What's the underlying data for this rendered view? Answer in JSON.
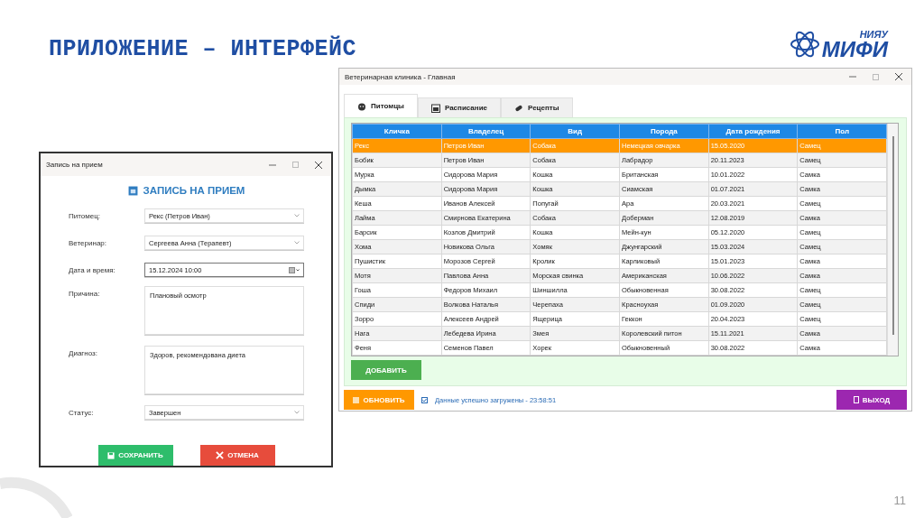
{
  "slide": {
    "title": "ПРИЛОЖЕНИЕ – ИНТЕРФЕЙС",
    "logo_small": "НИЯУ",
    "logo_big": "МИФИ",
    "page_number": "11"
  },
  "main_window": {
    "title": "Ветеринарная клиника - Главная",
    "tabs": [
      {
        "label": "Питомцы",
        "selected": true
      },
      {
        "label": "Расписание",
        "selected": false
      },
      {
        "label": "Рецепты",
        "selected": false
      }
    ],
    "table": {
      "columns": [
        "Кличка",
        "Владелец",
        "Вид",
        "Порода",
        "Дата рождения",
        "Пол"
      ],
      "rows": [
        {
          "cells": [
            "Рекс",
            "Петров Иван",
            "Собака",
            "Немецкая овчарка",
            "15.05.2020",
            "Самец"
          ],
          "selected": true
        },
        {
          "cells": [
            "Бобик",
            "Петров Иван",
            "Собака",
            "Лабрадор",
            "20.11.2023",
            "Самец"
          ],
          "selected": false
        },
        {
          "cells": [
            "Мурка",
            "Сидорова Мария",
            "Кошка",
            "Британская",
            "10.01.2022",
            "Самка"
          ],
          "selected": false
        },
        {
          "cells": [
            "Дымка",
            "Сидорова Мария",
            "Кошка",
            "Сиамская",
            "01.07.2021",
            "Самка"
          ],
          "selected": false
        },
        {
          "cells": [
            "Кеша",
            "Иванов Алексей",
            "Попугай",
            "Ара",
            "20.03.2021",
            "Самец"
          ],
          "selected": false
        },
        {
          "cells": [
            "Лайма",
            "Смирнова Екатерина",
            "Собака",
            "Доберман",
            "12.08.2019",
            "Самка"
          ],
          "selected": false
        },
        {
          "cells": [
            "Барсик",
            "Козлов Дмитрий",
            "Кошка",
            "Мейн-кун",
            "05.12.2020",
            "Самец"
          ],
          "selected": false
        },
        {
          "cells": [
            "Хома",
            "Новикова Ольга",
            "Хомяк",
            "Джунгарский",
            "15.03.2024",
            "Самец"
          ],
          "selected": false
        },
        {
          "cells": [
            "Пушистик",
            "Морозов Сергей",
            "Кролик",
            "Карликовый",
            "15.01.2023",
            "Самка"
          ],
          "selected": false
        },
        {
          "cells": [
            "Мотя",
            "Павлова Анна",
            "Морская свинка",
            "Американская",
            "10.06.2022",
            "Самка"
          ],
          "selected": false
        },
        {
          "cells": [
            "Гоша",
            "Федоров Михаил",
            "Шиншилла",
            "Обыкновенная",
            "30.08.2022",
            "Самец"
          ],
          "selected": false
        },
        {
          "cells": [
            "Спиди",
            "Волкова Наталья",
            "Черепаха",
            "Красноухая",
            "01.09.2020",
            "Самец"
          ],
          "selected": false
        },
        {
          "cells": [
            "Зорро",
            "Алексеев Андрей",
            "Ящерица",
            "Геккон",
            "20.04.2023",
            "Самец"
          ],
          "selected": false
        },
        {
          "cells": [
            "Нага",
            "Лебедева Ирина",
            "Змея",
            "Королевский питон",
            "15.11.2021",
            "Самка"
          ],
          "selected": false
        },
        {
          "cells": [
            "Феня",
            "Семенов Павел",
            "Хорек",
            "Обыкновенный",
            "30.08.2022",
            "Самка"
          ],
          "selected": false
        }
      ]
    },
    "add_button": "ДОБАВИТЬ",
    "refresh_button": "ОБНОВИТЬ",
    "status": "Данные успешно загружены - 23:58:51",
    "exit_button": "ВЫХОД"
  },
  "dialog": {
    "title": "Запись на прием",
    "heading": "ЗАПИСЬ НА ПРИЕМ",
    "fields": [
      {
        "label": "Питомец:",
        "kind": "select",
        "value": "Рекс (Петров Иван)"
      },
      {
        "label": "Ветеринар:",
        "kind": "select",
        "value": "Сергеева Анна (Терапевт)"
      },
      {
        "label": "Дата и время:",
        "kind": "datetime",
        "value": "15.12.2024 10:00"
      },
      {
        "label": "Причина:",
        "kind": "textarea",
        "value": "Плановый осмотр"
      },
      {
        "label": "Диагноз:",
        "kind": "textarea",
        "value": "Здоров, рекомендована диета"
      },
      {
        "label": "Статус:",
        "kind": "select",
        "value": "Завершен"
      }
    ],
    "buttons": [
      {
        "label": "СОХРАНИТЬ",
        "kind": "save"
      },
      {
        "label": "ОТМЕНА",
        "kind": "cancel"
      }
    ]
  }
}
